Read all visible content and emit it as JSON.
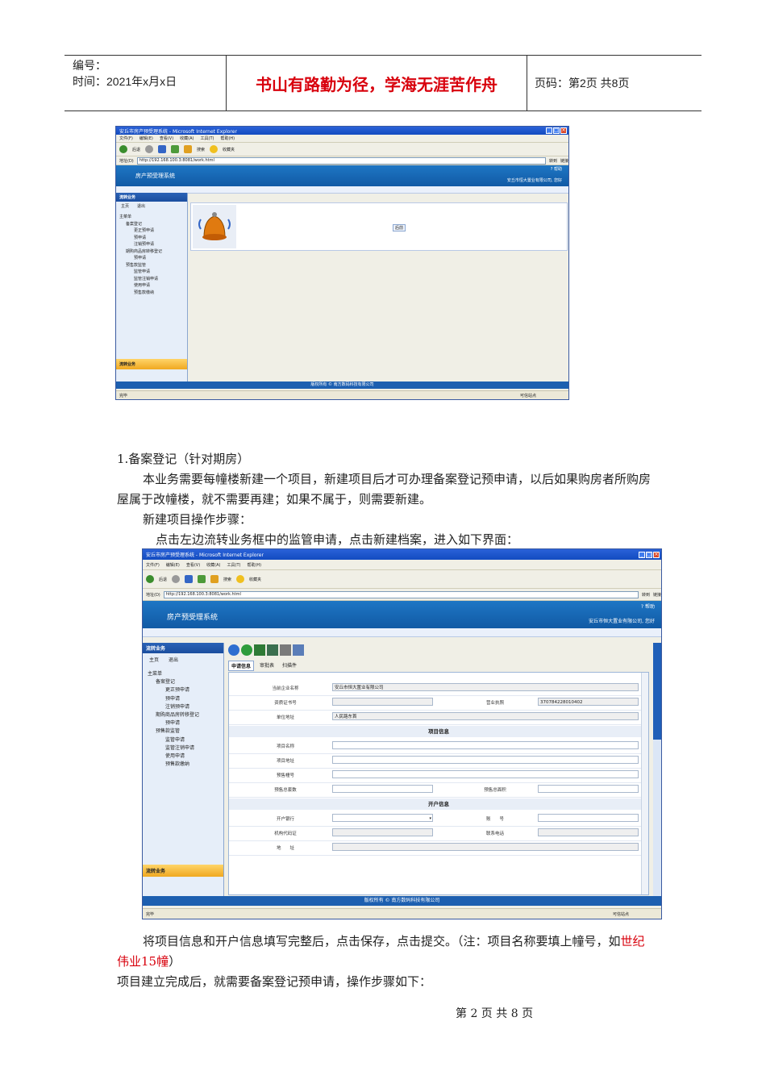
{
  "header": {
    "code_label": "编号：",
    "time_label": "时间：2021年x月x日",
    "motto": "书山有路勤为径，学海无涯苦作舟",
    "page_label": "页码：第2页  共8页"
  },
  "shot1": {
    "window_title": "安丘市房产预受理系统 - Microsoft Internet Explorer",
    "menu": [
      "文件(F)",
      "编辑(E)",
      "查看(V)",
      "收藏(A)",
      "工具(T)",
      "帮助(H)"
    ],
    "toolbar": [
      "后退",
      "搜索",
      "收藏夹"
    ],
    "address_label": "地址(D)",
    "address": "http://192.168.100.3:8081/work.html",
    "go_label": "转到",
    "links_label": "链接",
    "help": "? 帮助",
    "app_title": "房产预受理系统",
    "company": "安丘市恒大置业有限公司, 您好",
    "side_title": "流转业务",
    "side_home": "主页",
    "side_exit": "退出",
    "tree": [
      "主菜单",
      "备案登记",
      "更正预申请",
      "预申请",
      "注销预申请",
      "期购商品房转移登记",
      "预申请",
      "预售款监管",
      "监管申请",
      "监管注销申请",
      "使用申请",
      "预售款缴纳"
    ],
    "side_bottom": "流转业务",
    "back_btn": "后前",
    "footer": "版权所有 © 南方数码科技有限公司",
    "status_left": "完毕",
    "status_right": "可信站点"
  },
  "section_title": "1.备案登记（针对期房）",
  "para1": "本业务需要每幢楼新建一个项目，新建项目后才可办理备案登记预申请，以后如果购房者所购房屋属于改幢楼，就不需要再建；如果不属于，则需要新建。",
  "para2": "新建项目操作步骤：",
  "para3": "点击左边流转业务框中的监管申请，点击新建档案，进入如下界面：",
  "shot2": {
    "window_title": "安丘市房产预受理系统 - Microsoft Internet Explorer",
    "menu": [
      "文件(F)",
      "编辑(E)",
      "查看(V)",
      "收藏(A)",
      "工具(T)",
      "帮助(H)"
    ],
    "toolbar": [
      "后退",
      "搜索",
      "收藏夹"
    ],
    "address_label": "地址(D)",
    "address": "http://192.168.100.3:8081/work.html",
    "go_label": "转到",
    "links_label": "链接",
    "help": "? 帮助",
    "app_title": "房产预受理系统",
    "company": "安丘市恒大置业有限公司, 您好",
    "side_title": "流转业务",
    "side_home": "主页",
    "side_exit": "退出",
    "tree": [
      "主菜单",
      "备案登记",
      "更正预申请",
      "预申请",
      "注销预申请",
      "期购商品房转移登记",
      "预申请",
      "预售款监管",
      "监管申请",
      "监管注销申请",
      "使用申请",
      "预售款缴纳"
    ],
    "side_bottom": "流转业务",
    "tabs": [
      "申请信息",
      "审批表",
      "扫描件"
    ],
    "form": {
      "enterprise_label": "当前企业名称",
      "enterprise_value": "安丘市恒大置业有限公司",
      "cert_label": "资质证书号",
      "license_label": "营业执照",
      "license_value": "370784228010402",
      "address_label": "单位地址",
      "address_value": "人民路东首",
      "project_section": "项目信息",
      "project_name": "项目名称",
      "project_addr": "项目地址",
      "presale_building": "预售幢号",
      "presale_units": "预售总套数",
      "presale_area": "预售总面积",
      "account_section": "开户信息",
      "bank_label": "开户银行",
      "account_label": "账　　号",
      "org_code": "机构代码证",
      "phone": "联系电话",
      "addr": "地　　址"
    },
    "footer": "版权所有 © 南方数码科技有限公司",
    "status_left": "完毕",
    "status_right": "可信站点"
  },
  "para4_pre": "将项目信息和开户信息填写完整后，点击保存，点击提交。（注：项目名称要填上幢号，如",
  "para4_red": "世纪伟业15幢",
  "para4_post": "）",
  "para5": "项目建立完成后，就需要备案登记预申请，操作步骤如下：",
  "page_footer": "第 2 页 共 8 页"
}
